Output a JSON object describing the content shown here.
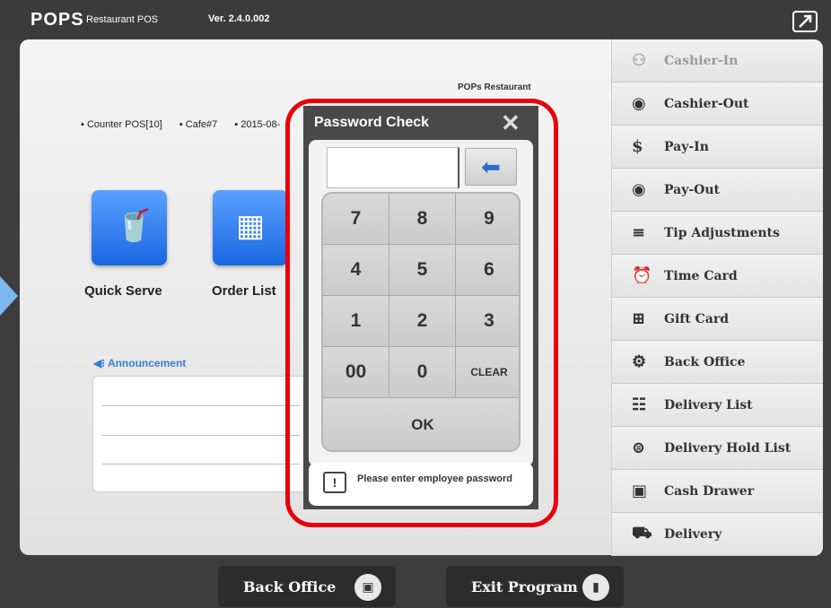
{
  "app": {
    "logo": "POPS",
    "logo_sub": "Restaurant POS",
    "version": "Ver. 2.4.0.002"
  },
  "status": {
    "pos": "Counter POS[10]",
    "store": "Cafe#7",
    "date": "2015-08-",
    "pops_info": "POPs Restaurant"
  },
  "tiles": [
    {
      "label": "Quick Serve",
      "icon": "cup-icon"
    },
    {
      "label": "Order List",
      "icon": "calculator-icon"
    }
  ],
  "announcement": {
    "label": "Announcement"
  },
  "right_menu": [
    {
      "label": "Cashier-In",
      "icon": "cashier-in-icon",
      "enabled": false
    },
    {
      "label": "Cashier-Out",
      "icon": "cashier-out-icon",
      "enabled": true
    },
    {
      "label": "Pay-In",
      "icon": "pay-in-icon",
      "enabled": true
    },
    {
      "label": "Pay-Out",
      "icon": "pay-out-icon",
      "enabled": true
    },
    {
      "label": "Tip Adjustments",
      "icon": "tip-icon",
      "enabled": true
    },
    {
      "label": "Time Card",
      "icon": "clock-icon",
      "enabled": true
    },
    {
      "label": "Gift Card",
      "icon": "gift-icon",
      "enabled": true
    },
    {
      "label": "Back Office",
      "icon": "gears-icon",
      "enabled": true
    },
    {
      "label": "Delivery List",
      "icon": "list-icon",
      "enabled": true
    },
    {
      "label": "Delivery Hold List",
      "icon": "hold-icon",
      "enabled": true
    },
    {
      "label": "Cash Drawer",
      "icon": "drawer-icon",
      "enabled": true
    },
    {
      "label": "Delivery",
      "icon": "truck-icon",
      "enabled": true
    }
  ],
  "bottom": {
    "back_office": "Back Office",
    "exit_program": "Exit Program"
  },
  "dialog": {
    "title": "Password Check",
    "close": "✕",
    "password_value": "",
    "keys": [
      "7",
      "8",
      "9",
      "4",
      "5",
      "6",
      "1",
      "2",
      "3",
      "00",
      "0",
      "CLEAR"
    ],
    "ok": "OK",
    "message": "Please enter employee password"
  },
  "colors": {
    "highlight": "#e8000a",
    "tile_blue": "#1966e0",
    "announce_blue": "#3a7ed0"
  }
}
